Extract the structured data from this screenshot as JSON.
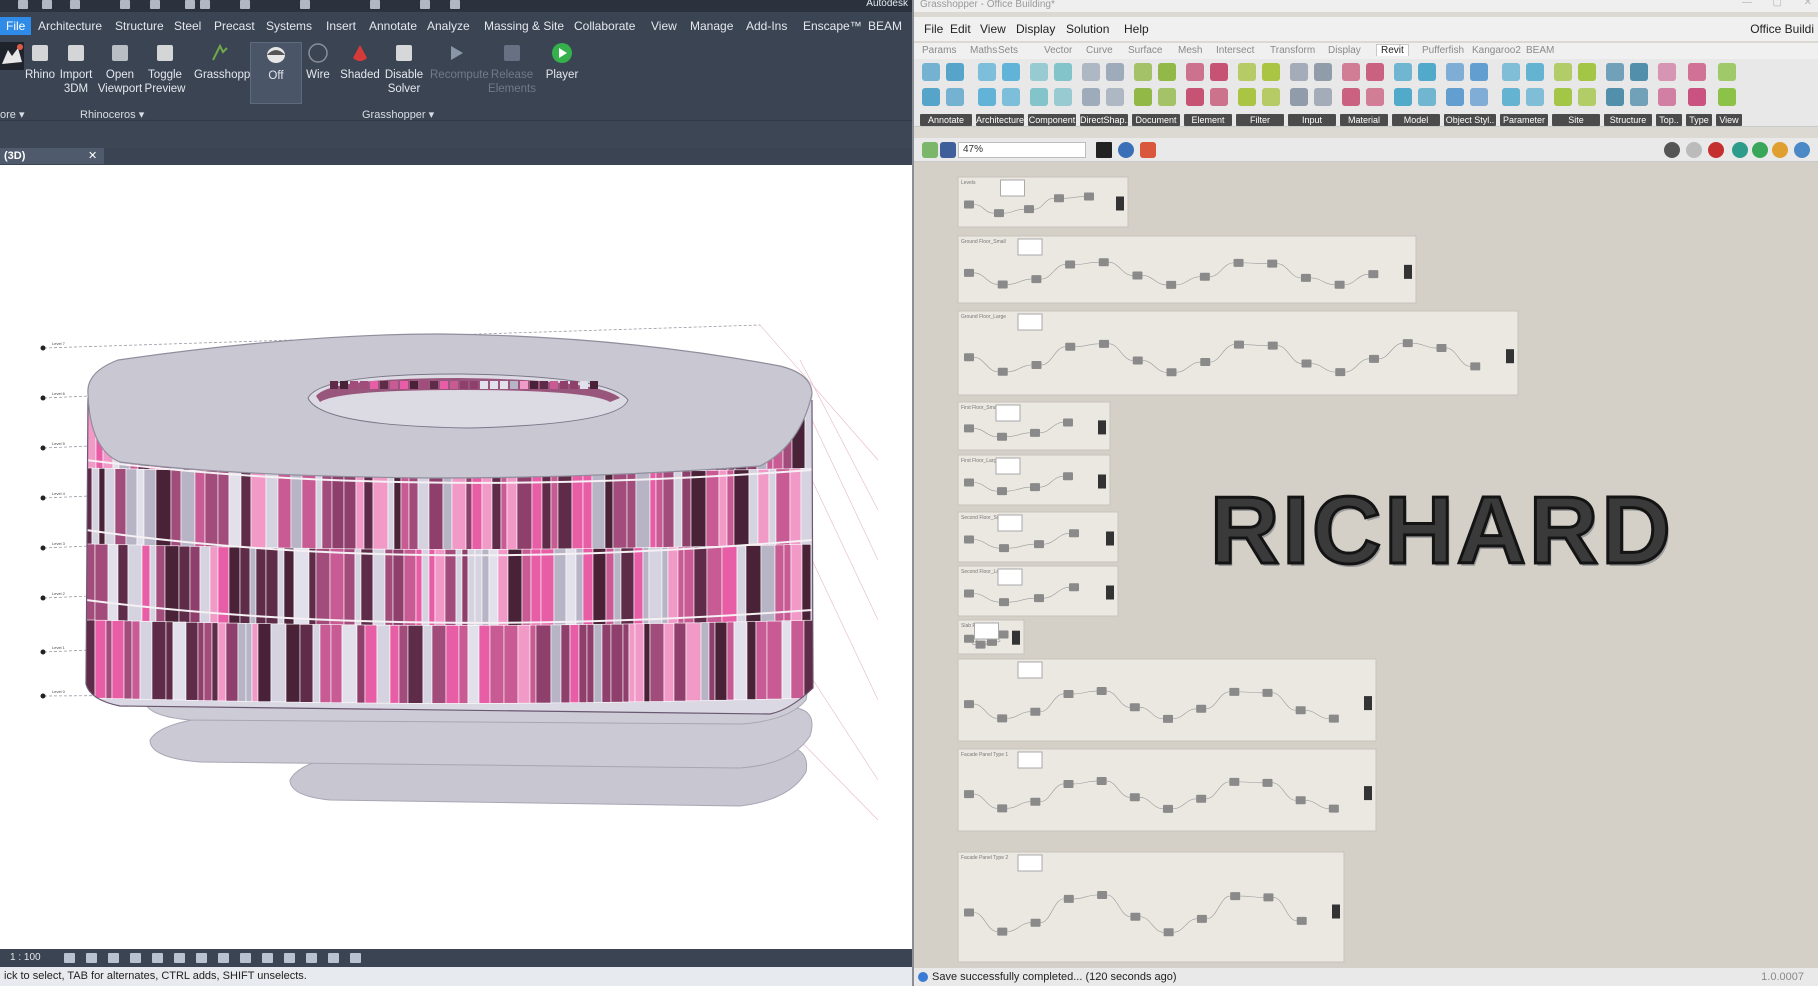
{
  "revit": {
    "app_name": "Autodesk",
    "menu": [
      "File",
      "Architecture",
      "Structure",
      "Steel",
      "Precast",
      "Systems",
      "Insert",
      "Annotate",
      "Analyze",
      "Massing & Site",
      "Collaborate",
      "View",
      "Manage",
      "Add-Ins",
      "Enscape™",
      "BEAM"
    ],
    "ribbon_buttons": [
      {
        "label": "Rhino",
        "icon": "rhino-icon"
      },
      {
        "label": "Import\n3DM",
        "icon": "import-3dm-icon"
      },
      {
        "label": "Open\nViewport",
        "icon": "open-viewport-icon"
      },
      {
        "label": "Toggle\nPreview",
        "icon": "toggle-preview-icon"
      },
      {
        "label": "Grasshopper",
        "icon": "grasshopper-icon"
      },
      {
        "label": "Off",
        "icon": "preview-off-icon"
      },
      {
        "label": "Wire",
        "icon": "wire-icon"
      },
      {
        "label": "Shaded",
        "icon": "shaded-icon"
      },
      {
        "label": "Disable\nSolver",
        "icon": "disable-solver-icon"
      },
      {
        "label": "Recompute",
        "icon": "recompute-icon"
      },
      {
        "label": "Release\nElements",
        "icon": "release-elements-icon"
      },
      {
        "label": "Player",
        "icon": "player-icon"
      }
    ],
    "groups": [
      "ore ▾",
      "Rhinoceros ▾",
      "Grasshopper ▾"
    ],
    "view_tab": "(3D)",
    "view_tab_close": "✕",
    "scale": "1 : 100",
    "status": "ick to select, TAB for alternates, CTRL adds, SHIFT unselects.",
    "level_labels": [
      "Level 7",
      "Level 6",
      "Level 5",
      "Level 4",
      "Level 3",
      "Level 2",
      "Level 1",
      "Level 0"
    ],
    "colors": {
      "dark_panel": "#3b4453",
      "facade_pink": "#e85ea6",
      "facade_dark": "#5e2b48",
      "slab": "#c9c8d3"
    }
  },
  "grasshopper": {
    "title": "Grasshopper - Office Building*",
    "menu": [
      "File",
      "Edit",
      "View",
      "Display",
      "Solution",
      "Help"
    ],
    "doc_name": "Office Buildi",
    "tabs": [
      "Params",
      "Maths",
      "Sets",
      "Vector",
      "Curve",
      "Surface",
      "Mesh",
      "Intersect",
      "Transform",
      "Display",
      "Revit",
      "Pufferfish",
      "Kangaroo2",
      "BEAM"
    ],
    "active_tab": "Revit",
    "sections": [
      "Annotate",
      "Architecture",
      "Component",
      "DirectShap..",
      "Document",
      "Element",
      "Filter",
      "Input",
      "Material",
      "Model",
      "Object Styl..",
      "Parameter",
      "Site",
      "Structure",
      "Top..",
      "Type",
      "View"
    ],
    "zoom": "47%",
    "groups": [
      "Levels",
      "Ground Floor_Small",
      "Ground Floor_Large",
      "First Floor_Small",
      "First Floor_Large",
      "Second Floor_Small",
      "Second Floor_Large",
      "Slab Floors",
      "",
      "Facade Panel Type 1",
      "Facade Panel Type 2"
    ],
    "status": "Save successfully completed... (120 seconds ago)",
    "version": "1.0.0007"
  },
  "overlay": {
    "text": "RICHARD"
  }
}
